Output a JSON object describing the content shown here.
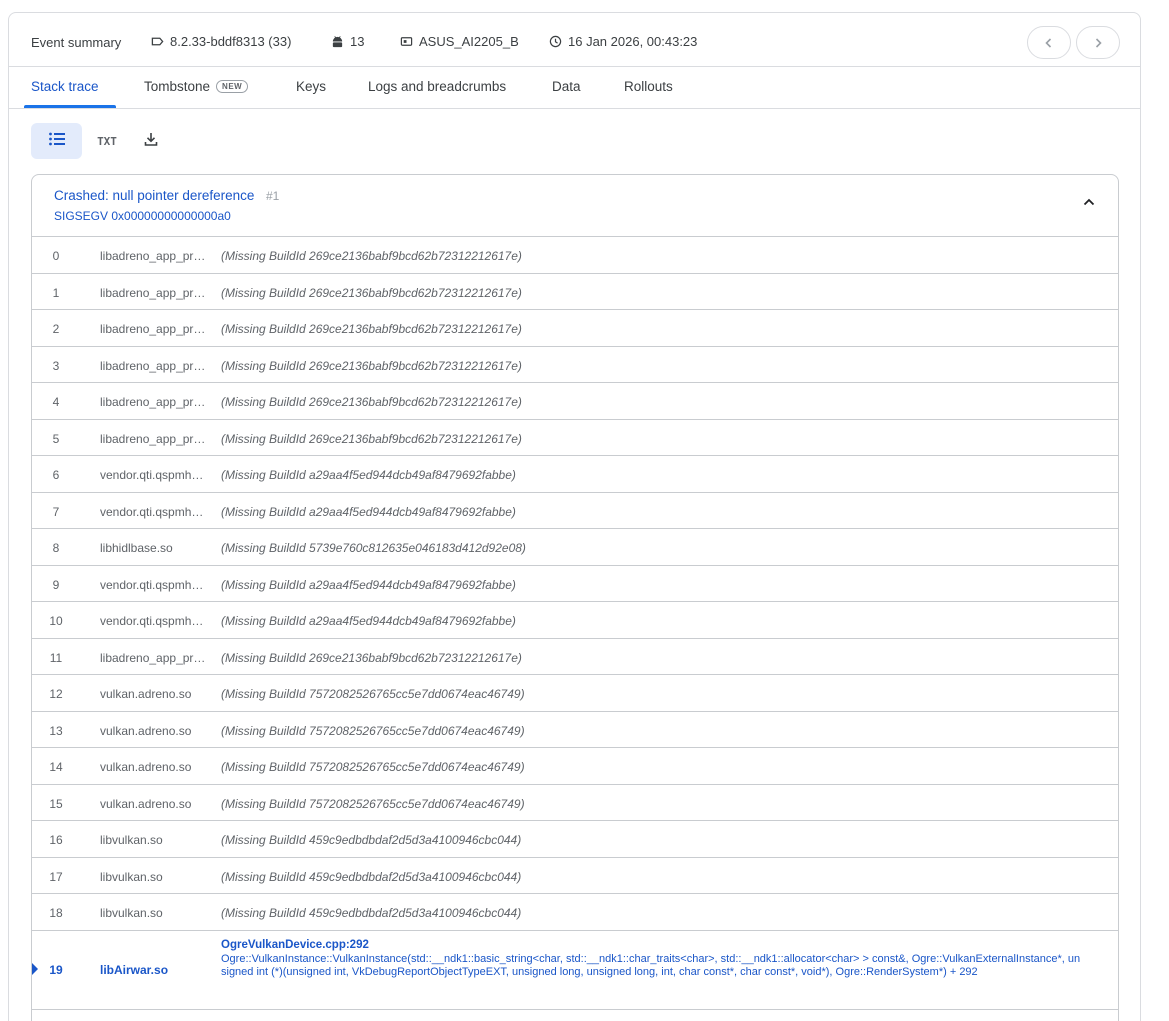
{
  "summary": {
    "title": "Event summary",
    "version": "8.2.33-bddf8313 (33)",
    "os": "13",
    "device": "ASUS_AI2205_B",
    "timestamp": "16 Jan 2026, 00:43:23"
  },
  "tabs": [
    {
      "label": "Stack trace",
      "active": true
    },
    {
      "label": "Tombstone",
      "badge": "NEW"
    },
    {
      "label": "Keys"
    },
    {
      "label": "Logs and breadcrumbs"
    },
    {
      "label": "Data"
    },
    {
      "label": "Rollouts"
    }
  ],
  "toolbar": {
    "list_icon": "list-icon",
    "txt_label": "TXT",
    "download_icon": "download-icon"
  },
  "trace": {
    "title": "Crashed: null pointer dereference",
    "number": "#1",
    "signal": "SIGSEGV 0x00000000000000a0",
    "frames": [
      {
        "index": "0",
        "lib": "libadreno_app_profiles.so",
        "msg": "(Missing BuildId 269ce2136babf9bcd62b72312212617e)"
      },
      {
        "index": "1",
        "lib": "libadreno_app_profiles.so",
        "msg": "(Missing BuildId 269ce2136babf9bcd62b72312212617e)"
      },
      {
        "index": "2",
        "lib": "libadreno_app_profiles.so",
        "msg": "(Missing BuildId 269ce2136babf9bcd62b72312212617e)"
      },
      {
        "index": "3",
        "lib": "libadreno_app_profiles.so",
        "msg": "(Missing BuildId 269ce2136babf9bcd62b72312212617e)"
      },
      {
        "index": "4",
        "lib": "libadreno_app_profiles.so",
        "msg": "(Missing BuildId 269ce2136babf9bcd62b72312212617e)"
      },
      {
        "index": "5",
        "lib": "libadreno_app_profiles.so",
        "msg": "(Missing BuildId 269ce2136babf9bcd62b72312212617e)"
      },
      {
        "index": "6",
        "lib": "vendor.qti.qspmhal.so",
        "msg": "(Missing BuildId a29aa4f5ed944dcb49af8479692fabbe)"
      },
      {
        "index": "7",
        "lib": "vendor.qti.qspmhal.so",
        "msg": "(Missing BuildId a29aa4f5ed944dcb49af8479692fabbe)"
      },
      {
        "index": "8",
        "lib": "libhidlbase.so",
        "msg": "(Missing BuildId 5739e760c812635e046183d412d92e08)"
      },
      {
        "index": "9",
        "lib": "vendor.qti.qspmhal.so",
        "msg": "(Missing BuildId a29aa4f5ed944dcb49af8479692fabbe)"
      },
      {
        "index": "10",
        "lib": "vendor.qti.qspmhal.so",
        "msg": "(Missing BuildId a29aa4f5ed944dcb49af8479692fabbe)"
      },
      {
        "index": "11",
        "lib": "libadreno_app_profiles.so",
        "msg": "(Missing BuildId 269ce2136babf9bcd62b72312212617e)"
      },
      {
        "index": "12",
        "lib": "vulkan.adreno.so",
        "msg": "(Missing BuildId 7572082526765cc5e7dd0674eac46749)"
      },
      {
        "index": "13",
        "lib": "vulkan.adreno.so",
        "msg": "(Missing BuildId 7572082526765cc5e7dd0674eac46749)"
      },
      {
        "index": "14",
        "lib": "vulkan.adreno.so",
        "msg": "(Missing BuildId 7572082526765cc5e7dd0674eac46749)"
      },
      {
        "index": "15",
        "lib": "vulkan.adreno.so",
        "msg": "(Missing BuildId 7572082526765cc5e7dd0674eac46749)"
      },
      {
        "index": "16",
        "lib": "libvulkan.so",
        "msg": "(Missing BuildId 459c9edbdbdaf2d5d3a4100946cbc044)"
      },
      {
        "index": "17",
        "lib": "libvulkan.so",
        "msg": "(Missing BuildId 459c9edbdbdaf2d5d3a4100946cbc044)"
      },
      {
        "index": "18",
        "lib": "libvulkan.so",
        "msg": "(Missing BuildId 459c9edbdbdaf2d5d3a4100946cbc044)"
      }
    ],
    "highlight": {
      "index": "19",
      "lib": "libAirwar.so",
      "file": "OgreVulkanDevice.cpp:292",
      "symbol": "Ogre::VulkanInstance::VulkanInstance(std::__ndk1::basic_string<char, std::__ndk1::char_traits<char>, std::__ndk1::allocator<char> > const&, Ogre::VulkanExternalInstance*, unsigned int (*)(unsigned int, VkDebugReportObjectTypeEXT, unsigned long, unsigned long, int, char const*, char const*, void*), Ogre::RenderSystem*) + 292"
    }
  },
  "colors": {
    "accent": "#1a56c8",
    "tab_underline": "#1a73e8",
    "border": "#dadce0"
  }
}
